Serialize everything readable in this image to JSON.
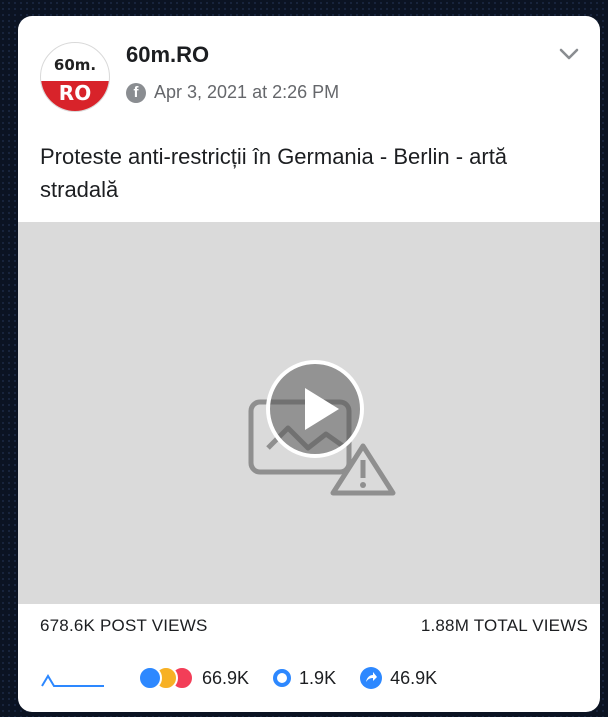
{
  "post": {
    "page_name": "60m.RO",
    "logo_top_text": "60m.",
    "logo_bottom_text": "RO",
    "timestamp": "Apr 3, 2021 at 2:26 PM",
    "text": "Proteste anti-restricții în Germania - Berlin - artă stradală"
  },
  "icons": {
    "platform": "facebook-icon",
    "menu": "chevron-down-icon",
    "video": "play-icon",
    "broken_media": "image-warning-icon",
    "trend": "sparkline-icon",
    "comments": "comment-icon",
    "shares": "share-icon"
  },
  "stats": {
    "post_views": "678.6K POST VIEWS",
    "total_views": "1.88M TOTAL VIEWS",
    "reactions": "66.9K",
    "comments": "1.9K",
    "shares": "46.9K"
  },
  "colors": {
    "brand_red": "#d8232a",
    "facebook_blue": "#2d88ff",
    "video_placeholder": "#dadada"
  }
}
